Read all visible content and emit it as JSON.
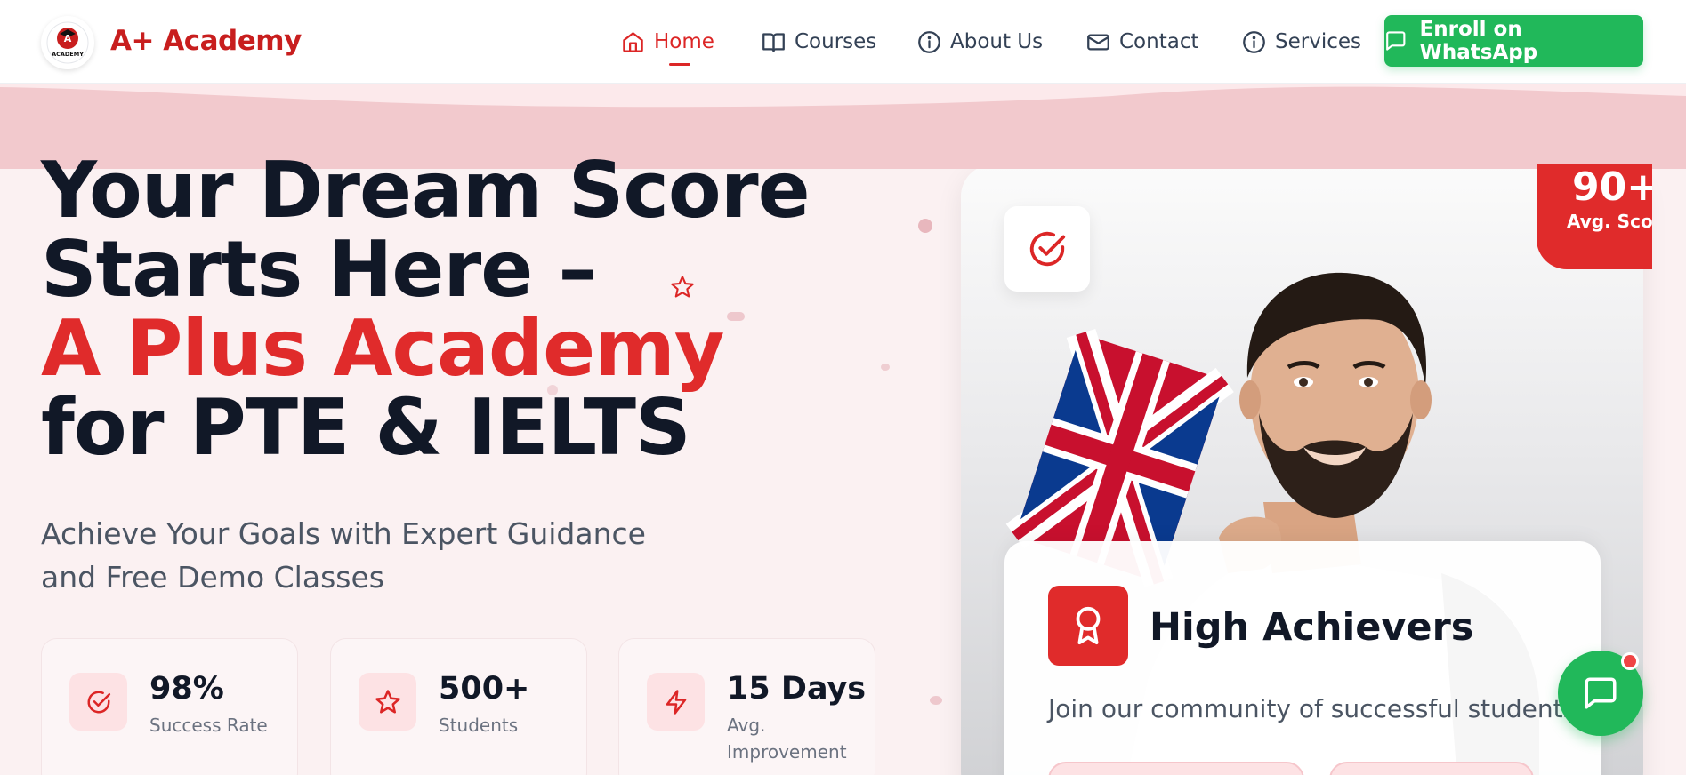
{
  "brand": {
    "name": "A+ Academy",
    "logo_text": "ACADEMY"
  },
  "nav": {
    "items": [
      {
        "label": "Home",
        "icon": "home-icon",
        "active": true
      },
      {
        "label": "Courses",
        "icon": "book-icon",
        "active": false
      },
      {
        "label": "About Us",
        "icon": "info-icon",
        "active": false
      },
      {
        "label": "Contact",
        "icon": "mail-icon",
        "active": false
      },
      {
        "label": "Services",
        "icon": "info-icon",
        "active": false
      }
    ],
    "cta_label": "Enroll on WhatsApp"
  },
  "hero": {
    "title_line1": "Your Dream Score",
    "title_line2": "Starts Here –",
    "title_line3": "A Plus Academy",
    "title_line4": "for PTE & IELTS",
    "subtitle_line1": "Achieve Your Goals with Expert Guidance",
    "subtitle_line2": "and Free Demo Classes"
  },
  "stats": [
    {
      "value": "98%",
      "label": "Success Rate",
      "icon": "check-circle-icon"
    },
    {
      "value": "500+",
      "label": "Students",
      "icon": "star-icon"
    },
    {
      "value": "15 Days",
      "label": "Avg. Improvement",
      "icon": "lightning-icon"
    }
  ],
  "score_badge": {
    "value": "90+",
    "label": "Avg. Score"
  },
  "achievers": {
    "title": "High Achievers",
    "text": "Join our community of successful students"
  },
  "colors": {
    "brand_red": "#e02b2b",
    "whatsapp_green": "#21b85a",
    "text_dark": "#111827"
  }
}
